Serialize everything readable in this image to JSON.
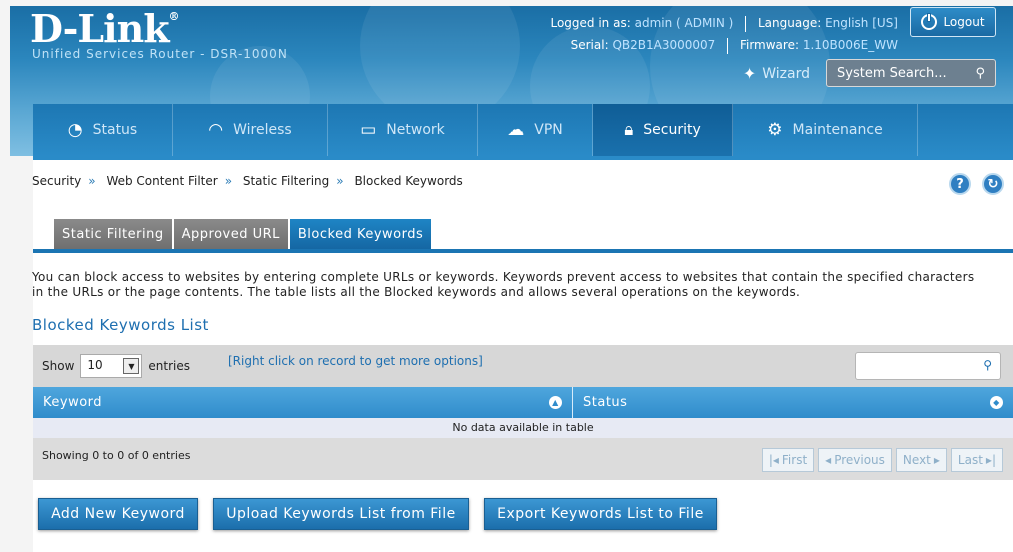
{
  "brand": {
    "logo": "D-Link",
    "subtitle": "Unified Services Router - DSR-1000N"
  },
  "topbar": {
    "logged_label": "Logged in as:",
    "logged_value": "admin ( ADMIN )",
    "language_label": "Language:",
    "language_value": "English [US]",
    "serial_label": "Serial:",
    "serial_value": "QB2B1A3000007",
    "firmware_label": "Firmware:",
    "firmware_value": "1.10B006E_WW",
    "logout": "Logout",
    "wizard": "Wizard",
    "search_placeholder": "System Search..."
  },
  "nav": {
    "items": [
      {
        "label": "Status",
        "icon": "dashboard-icon"
      },
      {
        "label": "Wireless",
        "icon": "wifi-icon"
      },
      {
        "label": "Network",
        "icon": "monitor-icon"
      },
      {
        "label": "VPN",
        "icon": "cloud-lock-icon"
      },
      {
        "label": "Security",
        "icon": "lock-icon"
      },
      {
        "label": "Maintenance",
        "icon": "gear-icon"
      }
    ],
    "active": "Security"
  },
  "breadcrumb": [
    "Security",
    "Web Content Filter",
    "Static Filtering",
    "Blocked Keywords"
  ],
  "tabs": [
    "Static Filtering",
    "Approved URL",
    "Blocked Keywords"
  ],
  "description": "You can block access to websites by entering complete URLs or keywords. Keywords prevent access to websites that contain the specified characters in the URLs or the page contents. The table lists all the Blocked keywords and allows several operations on the keywords.",
  "section_title": "Blocked Keywords List",
  "grid": {
    "show_label": "Show",
    "entries_value": "10",
    "entries_label": "entries",
    "right_click_hint": "[Right click on record to get more options]",
    "columns": [
      "Keyword",
      "Status"
    ],
    "empty_message": "No data available in table",
    "showing": "Showing 0 to 0 of 0 entries",
    "pager": [
      "First",
      "Previous",
      "Next",
      "Last"
    ]
  },
  "buttons": {
    "add": "Add New Keyword",
    "upload": "Upload Keywords List from File",
    "export": "Export Keywords List to File"
  },
  "colors": {
    "primary": "#2a8bc8",
    "active_tab": "#1567a3",
    "link": "#1e6fb0"
  }
}
